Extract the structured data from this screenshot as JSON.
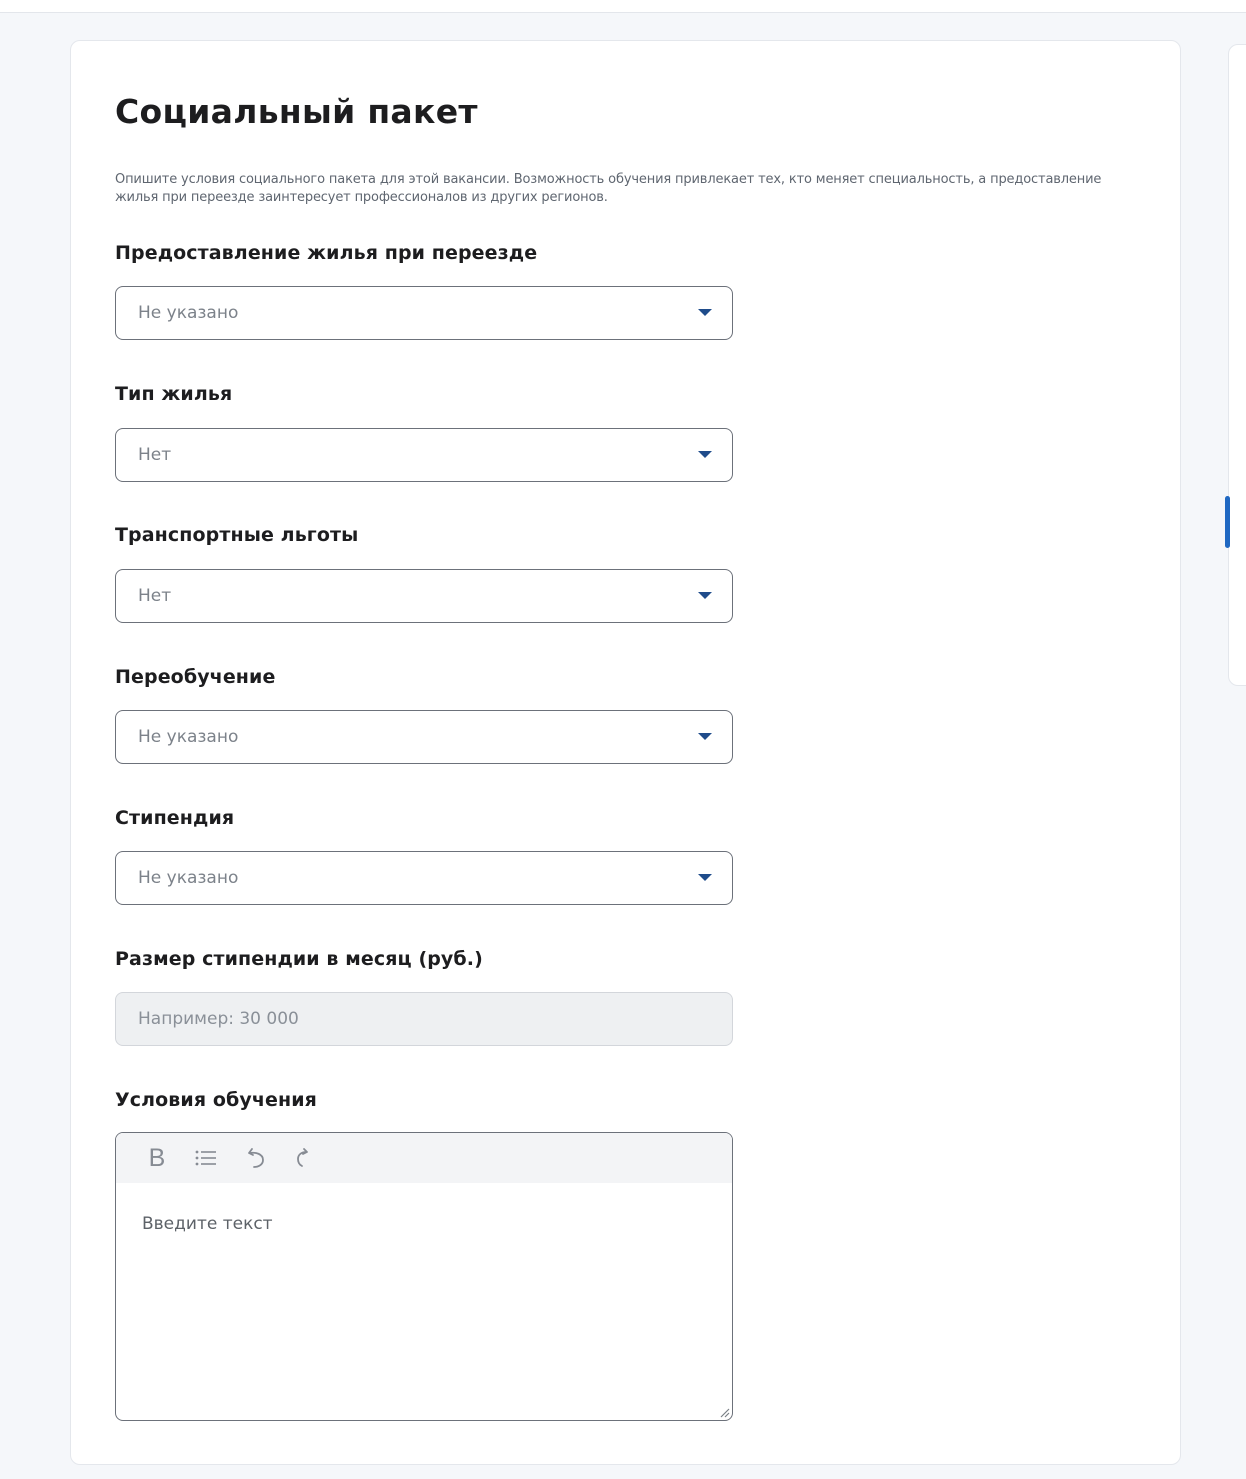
{
  "page": {
    "title": "Социальный пакет",
    "description": "Опишите условия социального пакета для этой вакансии. Возможность обучения привлекает тех, кто меняет специальность, а предоставление жилья при переезде заинтересует профессионалов из других регионов."
  },
  "fields": {
    "housing_relocation": {
      "label": "Предоставление жилья при переезде",
      "value": "Не указано"
    },
    "housing_type": {
      "label": "Тип жилья",
      "value": "Нет"
    },
    "transport_benefits": {
      "label": "Транспортные льготы",
      "value": "Нет"
    },
    "retraining": {
      "label": "Переобучение",
      "value": "Не указано"
    },
    "scholarship": {
      "label": "Стипендия",
      "value": "Не указано"
    },
    "scholarship_amount": {
      "label": "Размер стипендии в месяц (руб.)",
      "placeholder": "Например: 30 000"
    },
    "training_conditions": {
      "label": "Условия обучения",
      "placeholder": "Введите текст"
    }
  },
  "editor_toolbar": {
    "bold_label": "B",
    "icons": [
      "bold-icon",
      "list-icon",
      "undo-icon",
      "redo-icon"
    ]
  },
  "colors": {
    "accent": "#1f68c2",
    "caret": "#1f4c8b",
    "border": "#6c717a",
    "input_disabled_bg": "#eef0f2"
  }
}
